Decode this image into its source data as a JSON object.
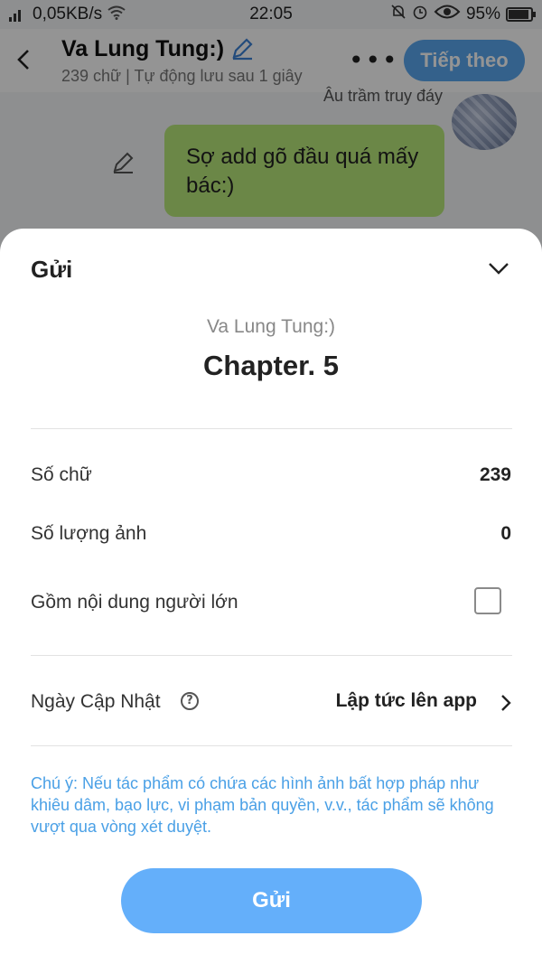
{
  "status_bar": {
    "network_speed": "0,05KB/s",
    "time": "22:05",
    "battery": "95%"
  },
  "header": {
    "back_icon": "chevron-left-icon",
    "title": "Va Lung Tung:)",
    "meta": "239 chữ | Tự động lưu sau 1 giây",
    "next_label": "Tiếp theo"
  },
  "chat": {
    "speaker": "Âu trầm truy đáy",
    "message": "Sợ add gõ đầu quá mấy bác:)"
  },
  "sheet": {
    "title": "Gửi",
    "story_name": "Va Lung Tung:)",
    "chapter_name": "Chapter. 5",
    "rows": {
      "word_count_label": "Số chữ",
      "word_count_value": "239",
      "image_count_label": "Số lượng ảnh",
      "image_count_value": "0",
      "adult_content_label": "Gồm nội dung người lớn",
      "adult_content_checked": false,
      "update_date_label": "Ngày Cập Nhật",
      "update_date_value": "Lập tức lên app"
    },
    "note": "Chú ý: Nếu tác phẩm có chứa các hình ảnh bất hợp pháp như khiêu dâm, bạo lực, vi phạm bản quyền, v.v., tác phẩm sẽ không vượt qua vòng xét duyệt.",
    "submit_label": "Gửi"
  },
  "colors": {
    "accent": "#64affa",
    "note": "#4aa0e6",
    "bubble": "#b9e97a"
  }
}
